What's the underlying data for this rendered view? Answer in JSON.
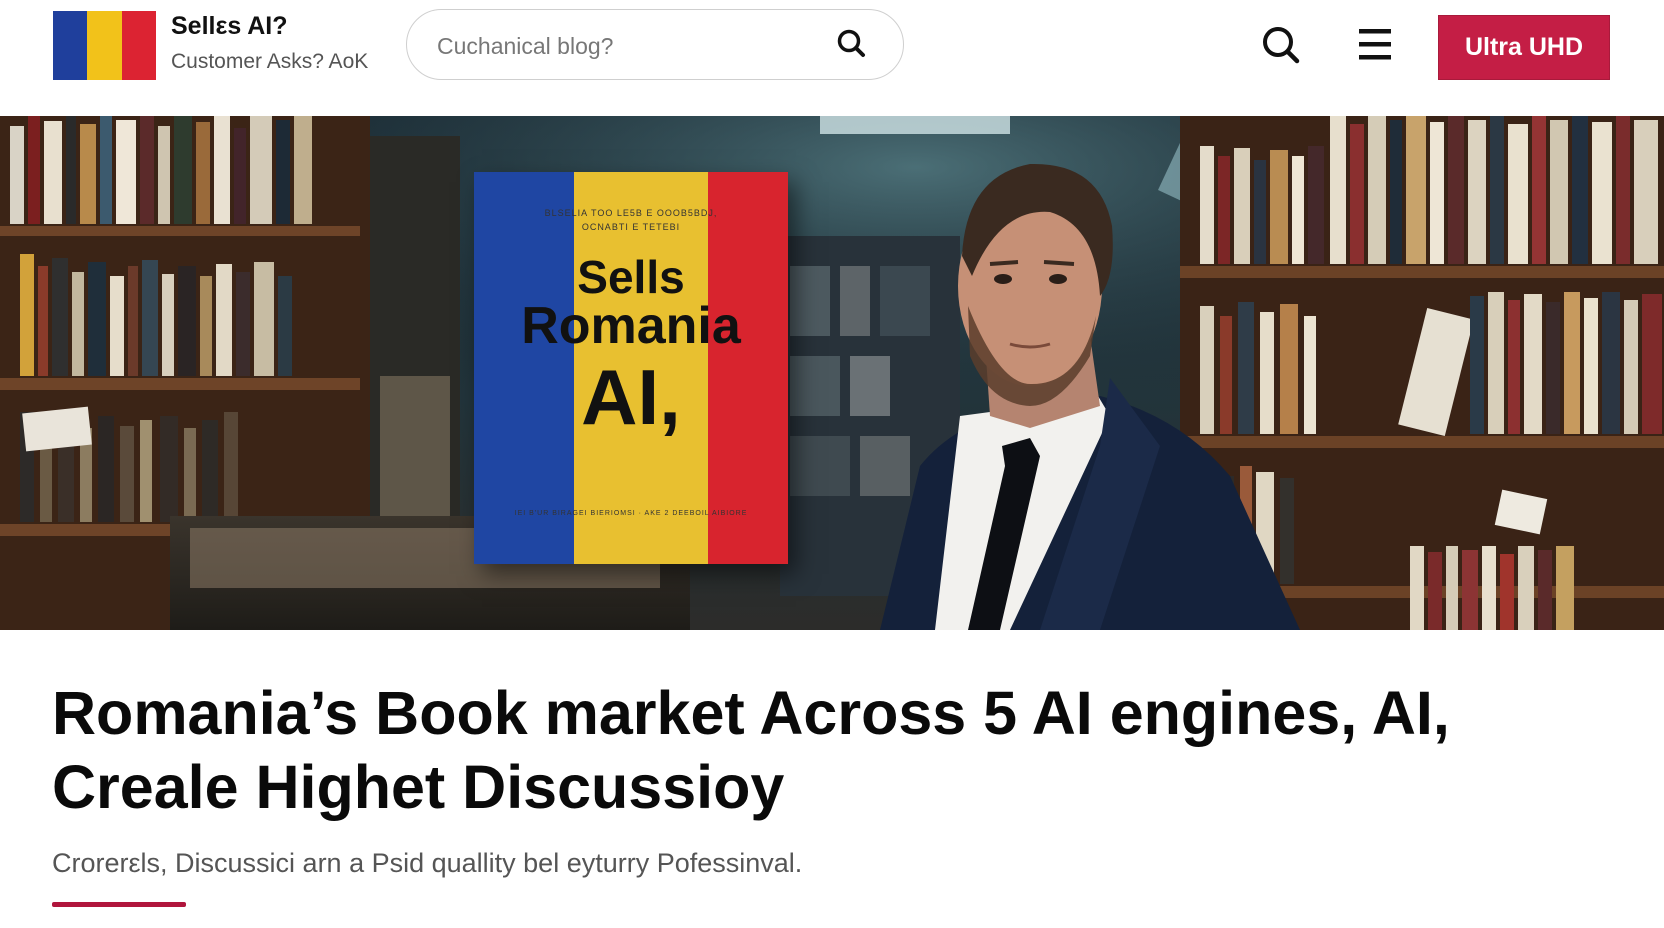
{
  "header": {
    "brand_title": "Sellεs AI?",
    "brand_subtitle": "Customer Asks? AoK",
    "logo_colors": [
      "#1f3f9c",
      "#f2c21a",
      "#dc2332"
    ],
    "search": {
      "placeholder": "Cuchanical blog?",
      "icon": "search-icon"
    },
    "actions": {
      "search_icon": "search-icon",
      "menu_icon": "hamburger-menu-icon",
      "cta_label": "Ultra UHD"
    },
    "accent_color": "#c41e45"
  },
  "hero": {
    "book": {
      "fine_line_1": "BLSELIA TOO LE5B E OOOB5BDJ,",
      "fine_line_2": "OCNABTI E TETEBI",
      "title_line_1": "Sells",
      "title_line_2": "Romania",
      "title_line_3": "AI,",
      "fine_line_3": "IEI B'UR BIRAGEI BIERIOMSI · AKE 2 DEEBOIL AIBIORE",
      "stripe_colors": [
        "#1f46a3",
        "#e8c030",
        "#d8242e"
      ]
    }
  },
  "article": {
    "title": "Romania’s Book market Across 5 AI engines, AI, Creale Highet Discussioy",
    "subtitle": "Crorerεls, Discussici arn a Psid quallity bel eyturry Pofessinval.",
    "accent_color": "#b0153c"
  }
}
